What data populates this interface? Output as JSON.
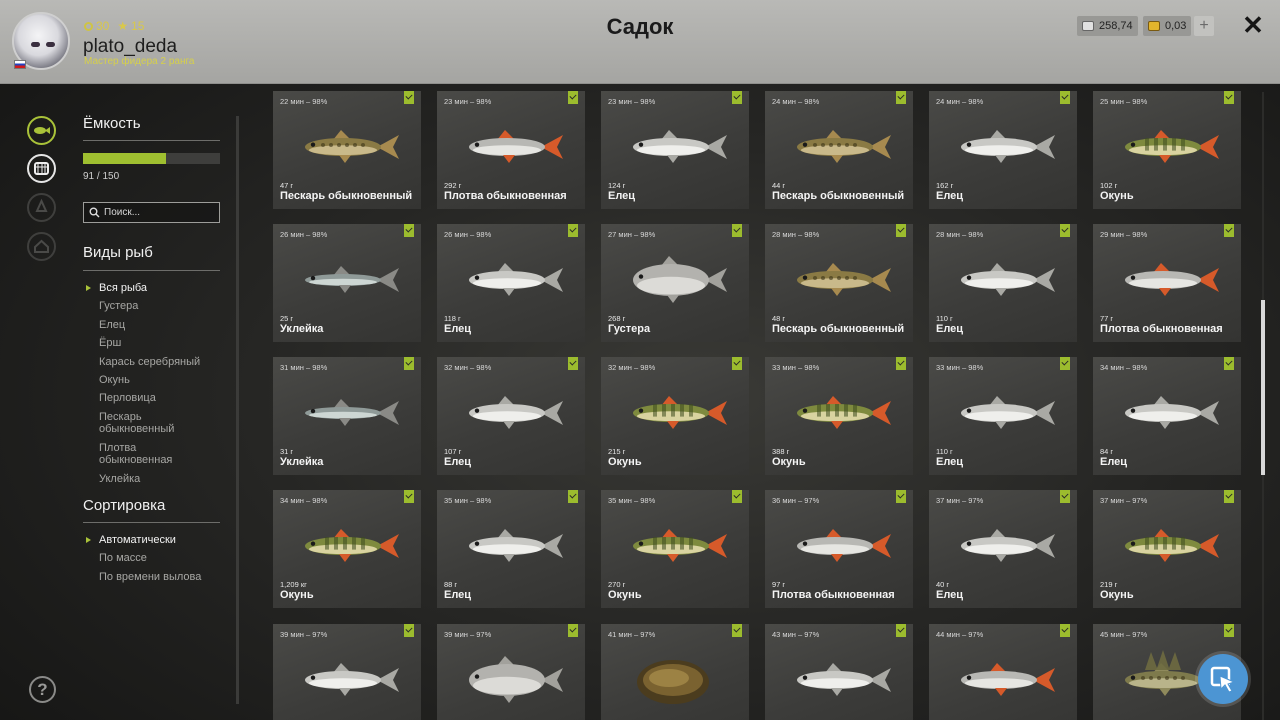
{
  "header": {
    "title": "Садок",
    "username": "plato_deda",
    "rank": "Мастер фидера 2 ранга",
    "coins": "30",
    "stars": "15",
    "silver": "258,74",
    "gold": "0,03",
    "add_label": "+",
    "close_label": "✕"
  },
  "capacity": {
    "title": "Ёмкость",
    "current": 91,
    "max": 150,
    "text": "91 / 150"
  },
  "search": {
    "placeholder": "Поиск..."
  },
  "species": {
    "title": "Виды рыб",
    "items": [
      "Вся рыба",
      "Густера",
      "Елец",
      "Ёрш",
      "Карась серебряный",
      "Окунь",
      "Перловица",
      "Пескарь обыкновенный",
      "Плотва обыкновенная",
      "Уклейка"
    ],
    "selected": 0
  },
  "sorting": {
    "title": "Сортировка",
    "items": [
      "Автоматически",
      "По массе",
      "По времени вылова"
    ],
    "selected": 0
  },
  "help_label": "?",
  "colors": {
    "accent": "#9fbf30",
    "fab": "#4c95d3"
  },
  "fish": [
    {
      "time": "22 мин – 98%",
      "weight": "47 г",
      "name": "Пескарь обыкновенный",
      "type": "gudgeon"
    },
    {
      "time": "23 мин – 98%",
      "weight": "292 г",
      "name": "Плотва обыкновенная",
      "type": "roach"
    },
    {
      "time": "23 мин – 98%",
      "weight": "124 г",
      "name": "Елец",
      "type": "dace"
    },
    {
      "time": "24 мин – 98%",
      "weight": "44 г",
      "name": "Пескарь обыкновенный",
      "type": "gudgeon"
    },
    {
      "time": "24 мин – 98%",
      "weight": "162 г",
      "name": "Елец",
      "type": "dace"
    },
    {
      "time": "25 мин – 98%",
      "weight": "102 г",
      "name": "Окунь",
      "type": "perch"
    },
    {
      "time": "26 мин – 98%",
      "weight": "25 г",
      "name": "Уклейка",
      "type": "bleak"
    },
    {
      "time": "26 мин – 98%",
      "weight": "118 г",
      "name": "Елец",
      "type": "dace"
    },
    {
      "time": "27 мин – 98%",
      "weight": "268 г",
      "name": "Густера",
      "type": "bream"
    },
    {
      "time": "28 мин – 98%",
      "weight": "48 г",
      "name": "Пескарь обыкновенный",
      "type": "gudgeon"
    },
    {
      "time": "28 мин – 98%",
      "weight": "110 г",
      "name": "Елец",
      "type": "dace"
    },
    {
      "time": "29 мин – 98%",
      "weight": "77 г",
      "name": "Плотва обыкновенная",
      "type": "roach"
    },
    {
      "time": "31 мин – 98%",
      "weight": "31 г",
      "name": "Уклейка",
      "type": "bleak"
    },
    {
      "time": "32 мин – 98%",
      "weight": "107 г",
      "name": "Елец",
      "type": "dace"
    },
    {
      "time": "32 мин – 98%",
      "weight": "215 г",
      "name": "Окунь",
      "type": "perch"
    },
    {
      "time": "33 мин – 98%",
      "weight": "388 г",
      "name": "Окунь",
      "type": "perch"
    },
    {
      "time": "33 мин – 98%",
      "weight": "110 г",
      "name": "Елец",
      "type": "dace"
    },
    {
      "time": "34 мин – 98%",
      "weight": "84 г",
      "name": "Елец",
      "type": "dace"
    },
    {
      "time": "34 мин – 98%",
      "weight": "1,209 кг",
      "name": "Окунь",
      "type": "perch"
    },
    {
      "time": "35 мин – 98%",
      "weight": "88 г",
      "name": "Елец",
      "type": "dace"
    },
    {
      "time": "35 мин – 98%",
      "weight": "270 г",
      "name": "Окунь",
      "type": "perch"
    },
    {
      "time": "36 мин – 97%",
      "weight": "97 г",
      "name": "Плотва обыкновенная",
      "type": "roach"
    },
    {
      "time": "37 мин – 97%",
      "weight": "40 г",
      "name": "Елец",
      "type": "dace"
    },
    {
      "time": "37 мин – 97%",
      "weight": "219 г",
      "name": "Окунь",
      "type": "perch"
    },
    {
      "time": "39 мин – 97%",
      "weight": "",
      "name": "",
      "type": "dace"
    },
    {
      "time": "39 мин – 97%",
      "weight": "",
      "name": "",
      "type": "bream"
    },
    {
      "time": "41 мин – 97%",
      "weight": "",
      "name": "",
      "type": "mussel"
    },
    {
      "time": "43 мин – 97%",
      "weight": "",
      "name": "",
      "type": "dace"
    },
    {
      "time": "44 мин – 97%",
      "weight": "",
      "name": "",
      "type": "roach"
    },
    {
      "time": "45 мин – 97%",
      "weight": "",
      "name": "",
      "type": "ruffe"
    }
  ]
}
